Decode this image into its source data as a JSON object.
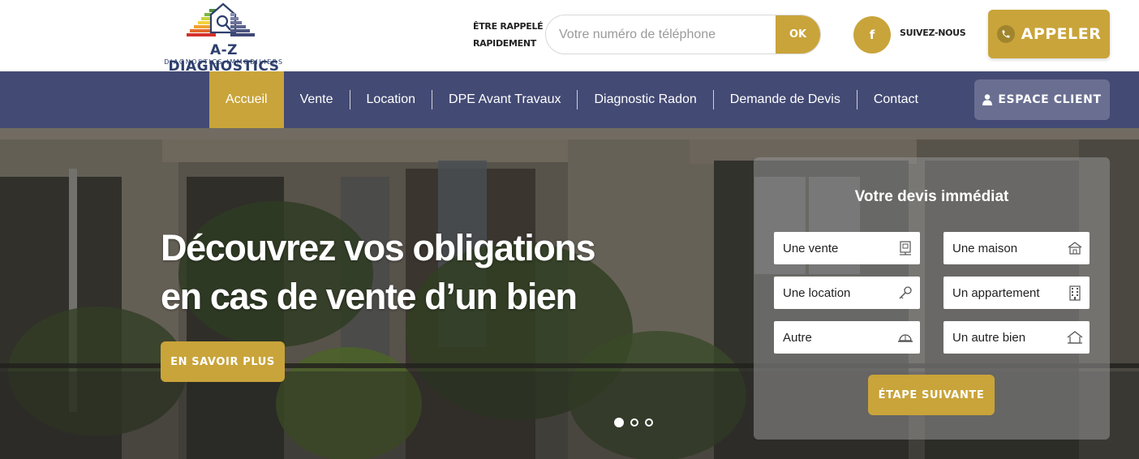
{
  "brand": {
    "name": "A-Z DIAGNOSTICS",
    "tagline": "DIAGNOSTICS IMMOBILIERS"
  },
  "header": {
    "callback_line1": "ÊTRE RAPPELÉ",
    "callback_line2": "RAPIDEMENT",
    "phone_placeholder": "Votre numéro de téléphone",
    "ok_label": "OK",
    "facebook_glyph": "f",
    "follow_label": "SUIVEZ-NOUS",
    "call_label": "APPELER"
  },
  "nav": {
    "items": [
      {
        "label": "Accueil",
        "active": true
      },
      {
        "label": "Vente"
      },
      {
        "label": "Location"
      },
      {
        "label": "DPE Avant Travaux"
      },
      {
        "label": "Diagnostic Radon"
      },
      {
        "label": "Demande de Devis"
      },
      {
        "label": "Contact"
      }
    ],
    "client_label": "ESPACE CLIENT"
  },
  "hero": {
    "title_line1": "Découvrez vos obligations",
    "title_line2": "en cas de vente d’un bien",
    "cta_label": "EN SAVOIR PLUS",
    "slides": 3,
    "active_slide": 1
  },
  "quote": {
    "title": "Votre devis immédiat",
    "options_left": [
      {
        "label": "Une vente",
        "icon": "sale-sign-icon"
      },
      {
        "label": "Une location",
        "icon": "key-icon"
      },
      {
        "label": "Autre",
        "icon": "hard-hat-icon"
      }
    ],
    "options_right": [
      {
        "label": "Une maison",
        "icon": "house-icon"
      },
      {
        "label": "Un appartement",
        "icon": "building-icon"
      },
      {
        "label": "Un autre bien",
        "icon": "home-outline-icon"
      }
    ],
    "next_label": "ÉTAPE SUIVANTE"
  },
  "colors": {
    "accent": "#c9a43a",
    "nav_bg": "#434a74",
    "brand_text": "#2e3f6d"
  }
}
